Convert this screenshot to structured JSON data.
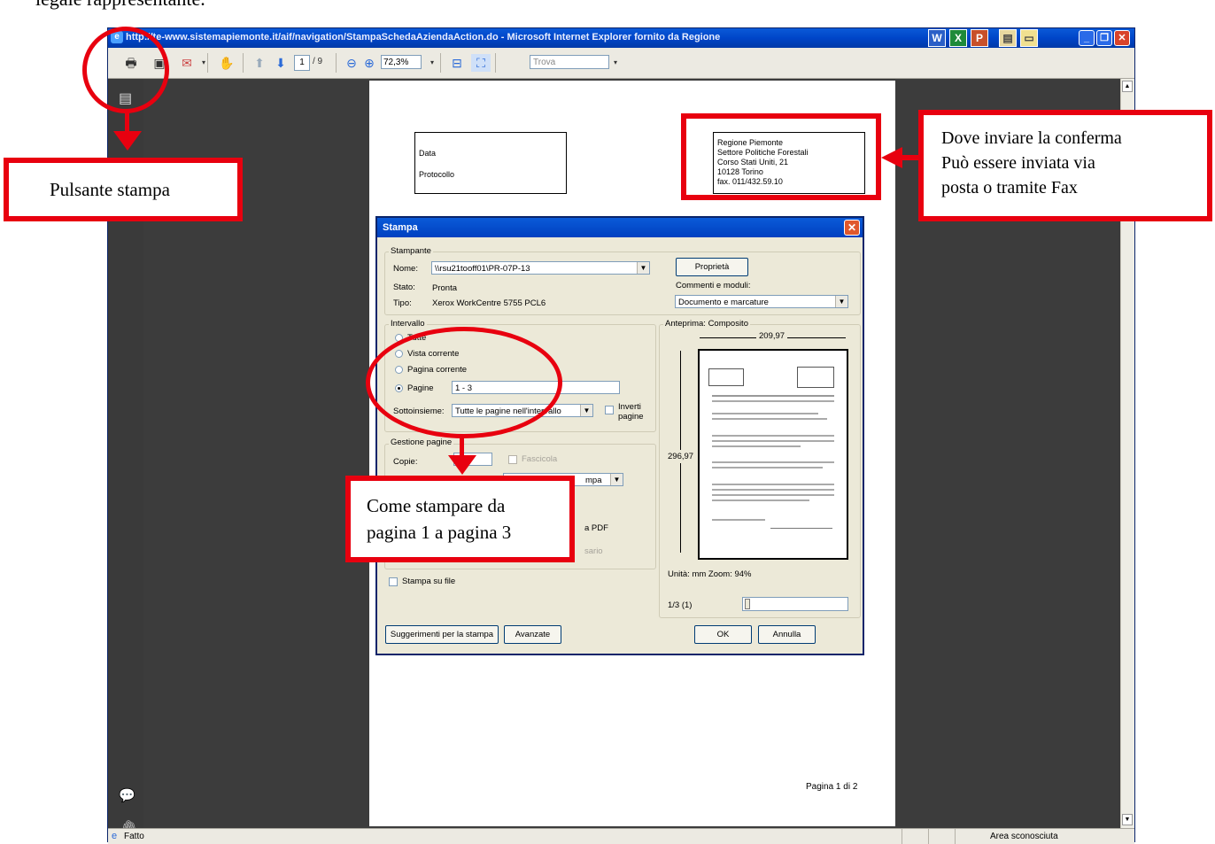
{
  "cut_text": "legale rappresentante.",
  "window": {
    "title": "http://te-www.sistemapiemonte.it/aif/navigation/StampaSchedaAziendaAction.do - Microsoft Internet Explorer fornito da Regione"
  },
  "toolbar": {
    "page_current": "1",
    "page_total": "/ 9",
    "zoom": "72,3%",
    "find_placeholder": "Trova"
  },
  "document": {
    "data_label": "Data",
    "protocollo_label": "Protocollo",
    "address_lines": [
      "Regione Piemonte",
      "Settore Politiche Forestali",
      "Corso Stati Uniti, 21",
      "10128 Torino",
      "fax. 011/432.59.10"
    ],
    "page_footer": "Pagina 1 di 2"
  },
  "dialog": {
    "title": "Stampa",
    "printer_group": "Stampante",
    "name_label": "Nome:",
    "name_value": "\\\\rsu21tooff01\\PR-07P-13",
    "status_label": "Stato:",
    "status_value": "Pronta",
    "type_label": "Tipo:",
    "type_value": "Xerox WorkCentre 5755 PCL6",
    "properties_button": "Proprietà",
    "comments_label": "Commenti e moduli:",
    "comments_value": "Documento e marcature",
    "range_group": "Intervallo",
    "range_all": "Tutte",
    "range_view": "Vista corrente",
    "range_current": "Pagina corrente",
    "range_pages": "Pagine",
    "range_pages_value": "1 - 3",
    "subset_label": "Sottoinsieme:",
    "subset_value": "Tutte le pagine nell'intervallo",
    "reverse_label_1": "Inverti",
    "reverse_label_2": "pagine",
    "page_handling_group": "Gestione pagine",
    "copies_label": "Copie:",
    "collate_label": "Fascicola",
    "scaling_partial": "mpa",
    "pdf_partial": "a PDF",
    "paper_partial": "sario",
    "print_to_file": "Stampa su file",
    "preview_group": "Anteprima: Composito",
    "preview_width": "209,97",
    "preview_height": "296,97",
    "units_zoom": "Unità: mm Zoom:  94%",
    "page_counter": "1/3 (1)",
    "tips_button": "Suggerimenti per la stampa",
    "advanced_button": "Avanzate",
    "ok_button": "OK",
    "cancel_button": "Annulla"
  },
  "status": {
    "left": "Fatto",
    "right": "Area sconosciuta"
  },
  "annotations": {
    "print_button_note": "Pulsante stampa",
    "send_note_line1": "Dove inviare la conferma",
    "send_note_line2": "Può essere inviata via",
    "send_note_line3": "posta o tramite Fax",
    "pages_note_line1": "Come  stampare  da",
    "pages_note_line2": "pagina 1 a pagina 3"
  },
  "colors": {
    "annotation_red": "#e8000f",
    "xp_blue": "#0045c8"
  }
}
